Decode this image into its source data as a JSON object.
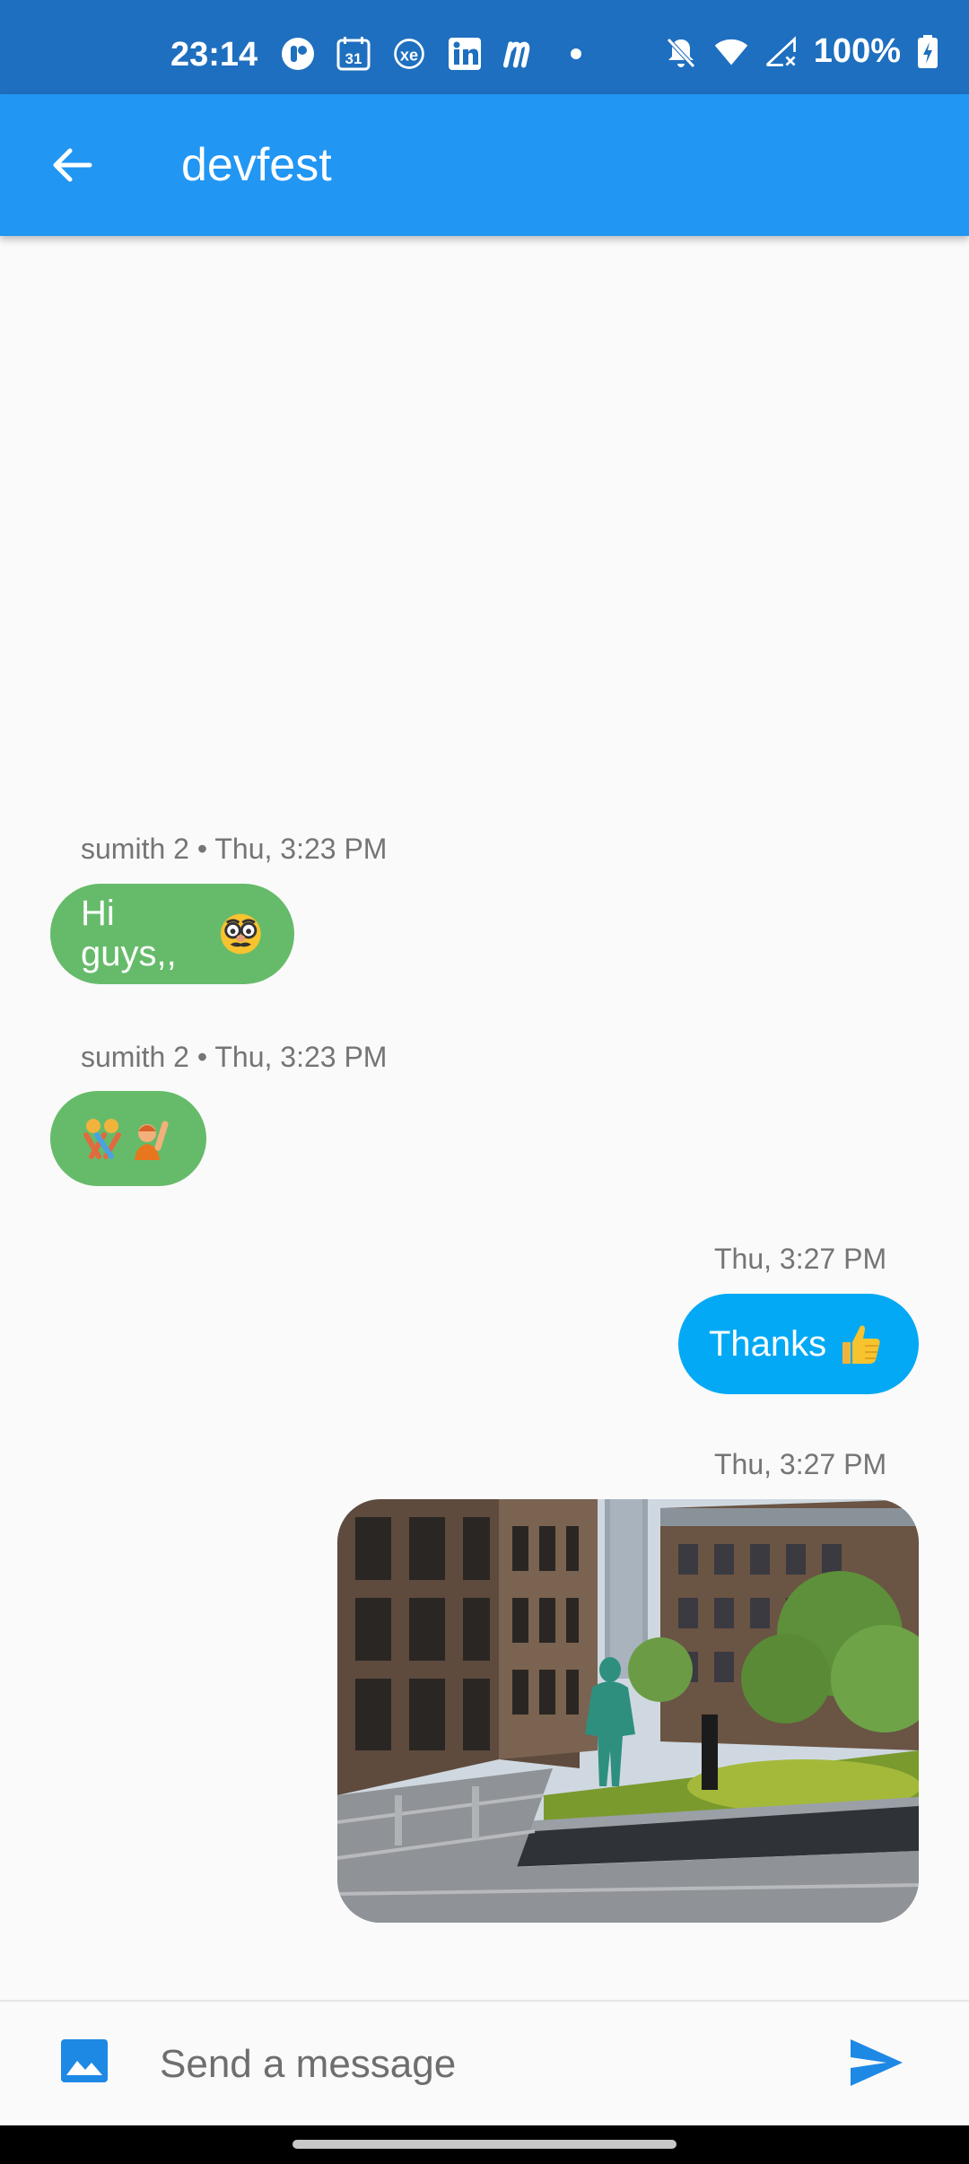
{
  "status_bar": {
    "time": "23:14",
    "calendar_day": "31",
    "xe_label": "xe",
    "battery": "100%",
    "icons": [
      "r-app-icon",
      "calendar-icon",
      "xe-icon",
      "linkedin-icon",
      "m-app-icon",
      "dot-icon",
      "bell-off-icon",
      "wifi-icon",
      "signal-icon",
      "battery-charging-icon"
    ]
  },
  "app_bar": {
    "title": "devfest",
    "back_icon": "arrow-left-icon"
  },
  "messages": [
    {
      "meta": "sumith 2 • Thu, 3:23 PM",
      "text": "Hi guys,,",
      "emoji": "disguised-face-emoji",
      "side": "left",
      "color": "#66bb6a"
    },
    {
      "meta": "sumith 2 • Thu, 3:23 PM",
      "text": "",
      "emoji": "people-wrestling-and-person-raising-hand-emoji",
      "side": "left",
      "color": "#66bb6a"
    },
    {
      "meta": "Thu, 3:27 PM",
      "text": "Thanks",
      "emoji": "thumbs-up-emoji",
      "side": "right",
      "color": "#03a9f4"
    },
    {
      "meta": "Thu, 3:27 PM",
      "text": "",
      "image": "courtyard-photo",
      "side": "right"
    }
  ],
  "composer": {
    "placeholder": "Send a message",
    "image_icon": "image-icon",
    "send_icon": "send-icon"
  },
  "colors": {
    "status_bar": "#1e6fbf",
    "app_bar": "#2196f3",
    "incoming_bubble": "#66bb6a",
    "outgoing_bubble": "#03a9f4",
    "background": "#fafafa"
  }
}
